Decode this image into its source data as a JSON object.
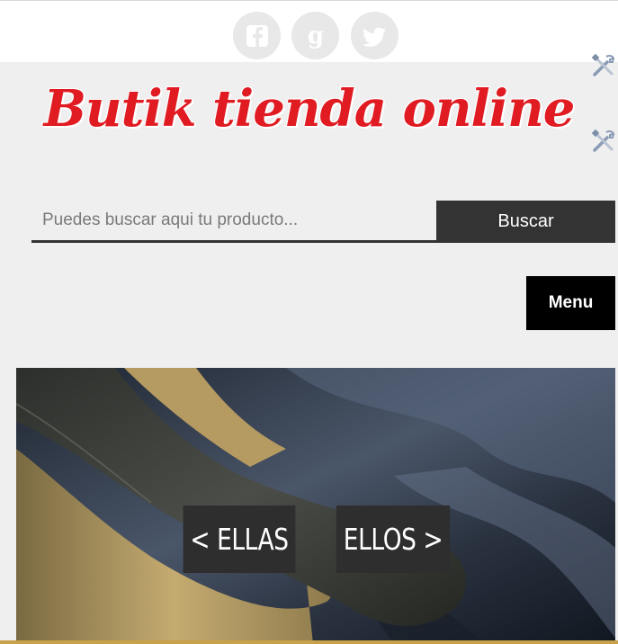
{
  "social": {
    "icons": [
      "facebook-icon",
      "google-plus-icon",
      "twitter-icon"
    ]
  },
  "logo": {
    "text": "Butik tienda online",
    "color": "#e01b22"
  },
  "search": {
    "placeholder": "Puedes buscar aqui tu producto...",
    "value": "",
    "button_label": "Buscar"
  },
  "menu": {
    "label": "Menu"
  },
  "hero": {
    "ellas_label": "< ELLAS",
    "ellos_label": "ELLOS >"
  },
  "colors": {
    "background": "#efefef",
    "button_dark": "#333333",
    "menu_bg": "#000000"
  }
}
